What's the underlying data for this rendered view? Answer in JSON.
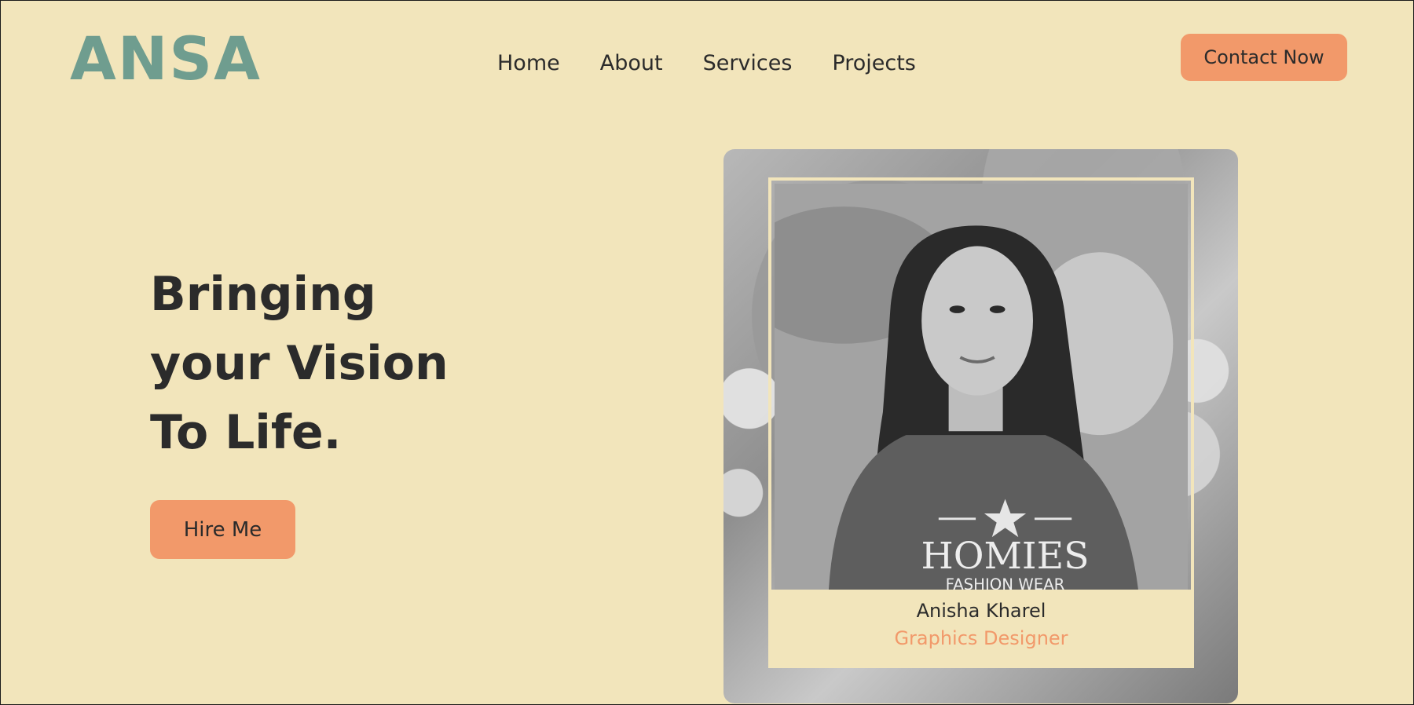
{
  "header": {
    "logo": "ANSA",
    "nav": [
      "Home",
      "About",
      "Services",
      "Projects"
    ],
    "contact_label": "Contact Now"
  },
  "hero": {
    "title_lines": [
      "Bringing",
      "your Vision",
      "To Life."
    ],
    "hire_label": "Hire Me"
  },
  "profile": {
    "name": "Anisha Kharel",
    "role": "Graphics Designer",
    "shirt_text_top": "HOMIES",
    "shirt_text_bottom": "FASHION WEAR"
  },
  "colors": {
    "background": "#f2e5bb",
    "accent": "#f2996a",
    "logo": "#6f9d8f",
    "text": "#2b2b2b"
  }
}
